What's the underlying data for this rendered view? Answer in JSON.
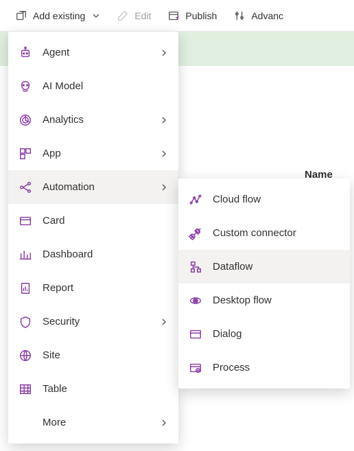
{
  "toolbar": {
    "add_existing": "Add existing",
    "edit": "Edit",
    "publish": "Publish",
    "advanced": "Advanc"
  },
  "background": {
    "name_header": "Name"
  },
  "menu": [
    {
      "label": "Agent",
      "sub": true
    },
    {
      "label": "AI Model",
      "sub": false
    },
    {
      "label": "Analytics",
      "sub": true
    },
    {
      "label": "App",
      "sub": true
    },
    {
      "label": "Automation",
      "sub": true,
      "hover": true
    },
    {
      "label": "Card",
      "sub": false
    },
    {
      "label": "Dashboard",
      "sub": false
    },
    {
      "label": "Report",
      "sub": false
    },
    {
      "label": "Security",
      "sub": true
    },
    {
      "label": "Site",
      "sub": false
    },
    {
      "label": "Table",
      "sub": false
    },
    {
      "label": "More",
      "sub": true,
      "more": true
    }
  ],
  "submenu": [
    {
      "label": "Cloud flow"
    },
    {
      "label": "Custom connector"
    },
    {
      "label": "Dataflow",
      "hover": true
    },
    {
      "label": "Desktop flow"
    },
    {
      "label": "Dialog"
    },
    {
      "label": "Process"
    }
  ]
}
